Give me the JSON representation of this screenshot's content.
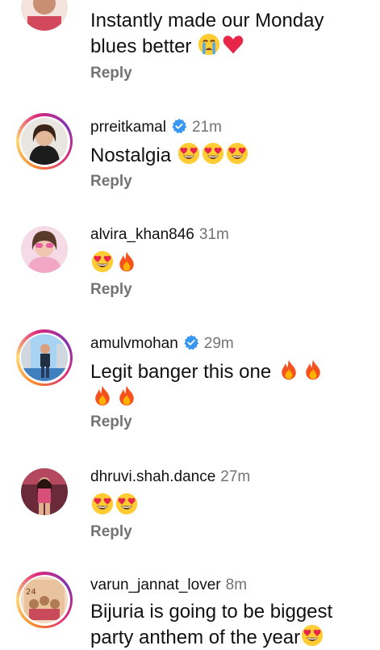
{
  "comments": [
    {
      "username": "",
      "time": "",
      "text": "Instantly made our Monday blues better",
      "emojis": [
        "crying-face",
        "red-heart"
      ],
      "reply_label": "Reply",
      "verified": false,
      "story_ring": false
    },
    {
      "username": "prreitkamal",
      "time": "21m",
      "text": "Nostalgia",
      "emojis": [
        "heart-eyes",
        "heart-eyes",
        "heart-eyes"
      ],
      "reply_label": "Reply",
      "verified": true,
      "story_ring": true
    },
    {
      "username": "alvira_khan846",
      "time": "31m",
      "text": "",
      "emojis": [
        "heart-eyes",
        "fire"
      ],
      "reply_label": "Reply",
      "verified": false,
      "story_ring": false
    },
    {
      "username": "amulvmohan",
      "time": "29m",
      "text": "Legit banger this one",
      "emojis": [
        "fire",
        "fire",
        "fire",
        "fire"
      ],
      "reply_label": "Reply",
      "verified": true,
      "story_ring": true
    },
    {
      "username": "dhruvi.shah.dance",
      "time": "27m",
      "text": "",
      "emojis": [
        "heart-eyes",
        "heart-eyes"
      ],
      "reply_label": "Reply",
      "verified": false,
      "story_ring": false
    },
    {
      "username": "varun_jannat_lover",
      "time": "8m",
      "text": "Bijuria is going to be biggest party anthem of the year",
      "emojis": [
        "heart-eyes"
      ],
      "reply_label": "",
      "verified": false,
      "story_ring": true
    }
  ],
  "colors": {
    "verified_blue": "#3897f0",
    "muted_text": "#737373",
    "ring_gradient": [
      "#f58529",
      "#feda77",
      "#dd2a7b",
      "#8134af"
    ]
  }
}
